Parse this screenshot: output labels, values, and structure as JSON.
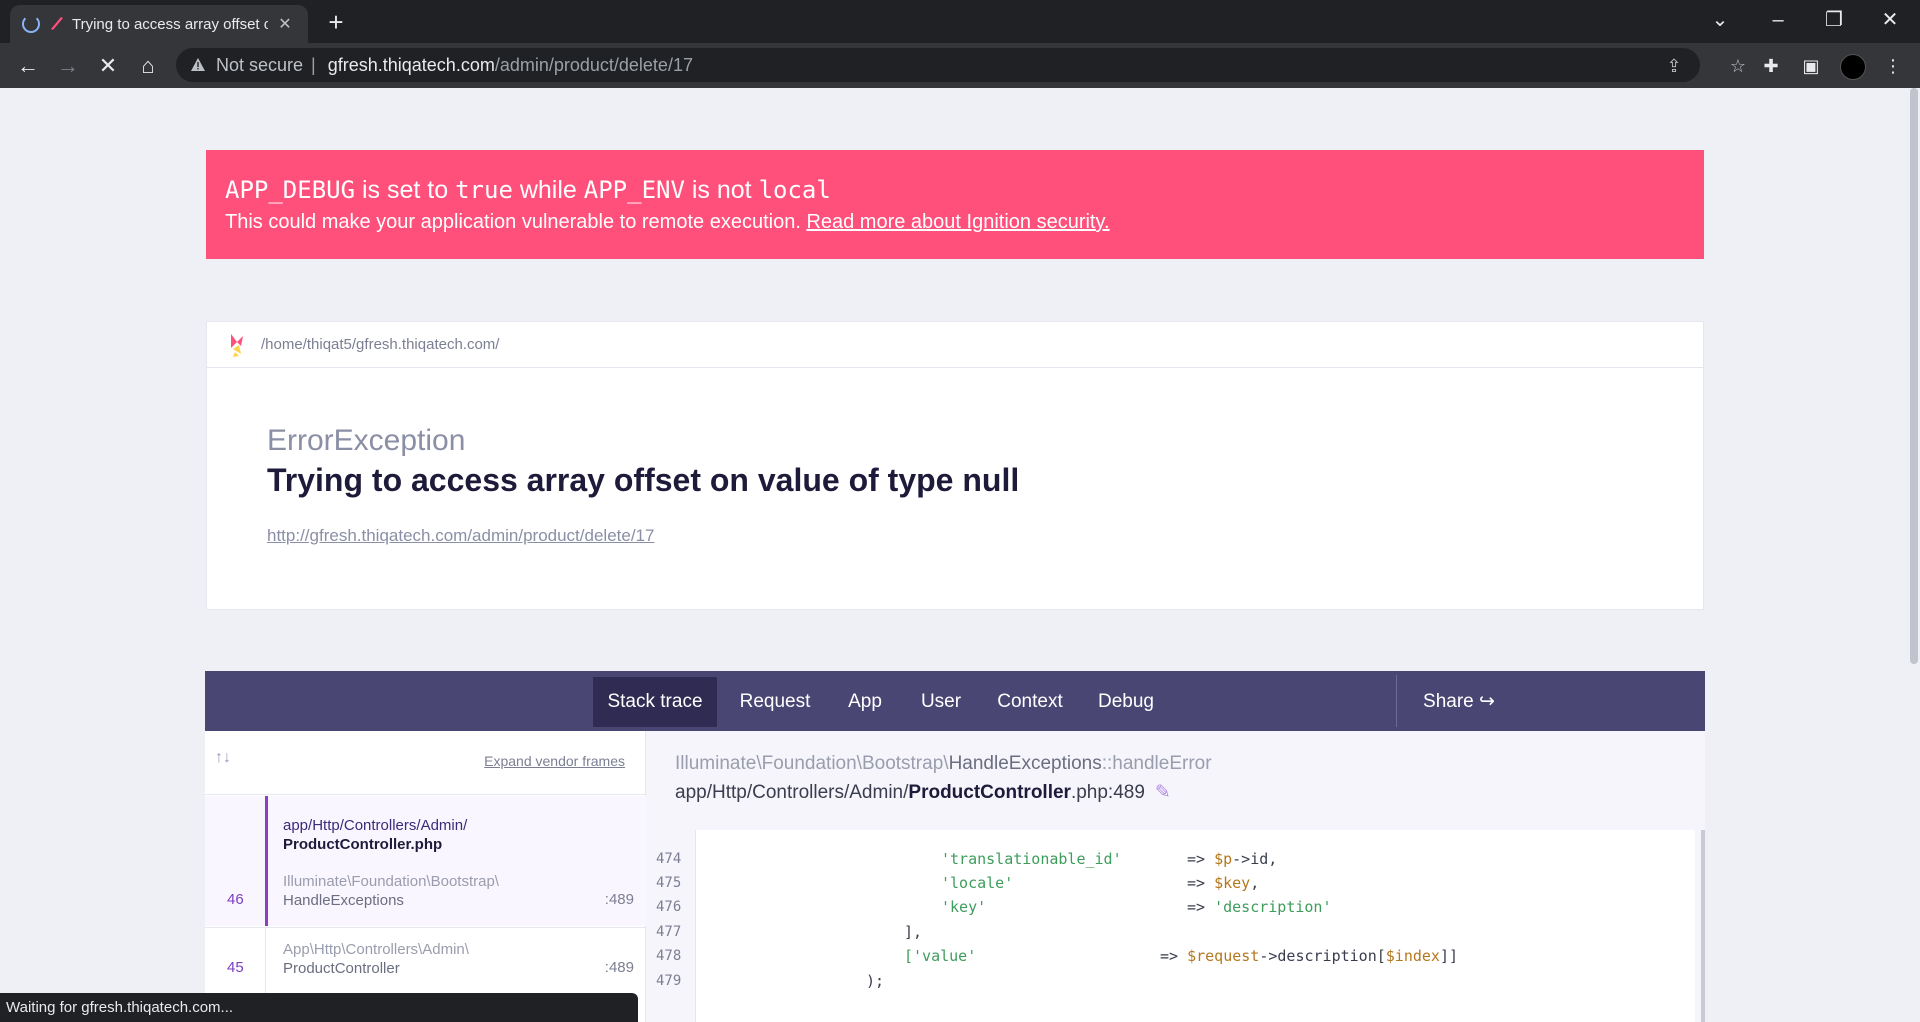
{
  "browser": {
    "tab_title": "Trying to access array offset on value of type null",
    "tab_close": "✕",
    "new_tab": "+",
    "not_secure": "Not secure",
    "url_host": "gfresh.thiqatech.com",
    "url_path": "/admin/product/delete/17",
    "status": "Waiting for gfresh.thiqatech.com..."
  },
  "banner": {
    "prefix_code": "APP_DEBUG",
    "text1": " is set to ",
    "code2": "true",
    "text2": " while ",
    "code3": "APP_ENV",
    "text3": " is not ",
    "code4": "local",
    "body": "This could make your application vulnerable to remote execution. ",
    "link": "Read more about Ignition security."
  },
  "error": {
    "path": "/home/thiqat5/gfresh.thiqatech.com/",
    "exception_class": "ErrorException",
    "message": "Trying to access array offset on value of type null",
    "url": "http://gfresh.thiqatech.com/admin/product/delete/17"
  },
  "tabs": [
    "Stack trace",
    "Request",
    "App",
    "User",
    "Context",
    "Debug"
  ],
  "share_label": "Share",
  "frames": {
    "expand_label": "Expand vendor frames",
    "items": [
      {
        "index": "46",
        "file_dir": "app/Http/Controllers/Admin/",
        "file_name": "ProductController.php",
        "cls_ns": "Illuminate\\Foundation\\Bootstrap\\",
        "cls_name": "HandleExceptions",
        "line": ":489"
      },
      {
        "index": "45",
        "cls_ns": "App\\Http\\Controllers\\Admin\\",
        "cls_name": "ProductController",
        "line": ":489"
      }
    ]
  },
  "code": {
    "ns": "Illuminate\\Foundation\\Bootstrap\\",
    "cls": "HandleExceptions",
    "method": "::handleError",
    "file_dir": "app/Http/Controllers/Admin/",
    "file_name": "ProductController",
    "file_ext": ".php:489",
    "lines": [
      {
        "no": "474",
        "key": "'translationable_id'",
        "arrow": "=> ",
        "val_var": "$p",
        "val_rest": "->id,"
      },
      {
        "no": "475",
        "key": "'locale'",
        "arrow": "=> ",
        "val_var": "$key",
        "val_rest": ","
      },
      {
        "no": "476",
        "key": "'key'",
        "arrow": "=> ",
        "val_str": "'description'"
      },
      {
        "no": "477",
        "text": "],"
      },
      {
        "no": "478",
        "key": "['value'",
        "arrow": "=> ",
        "val_var": "$request",
        "val_mid": "->description[",
        "val_var2": "$index",
        "val_rest": "]]"
      },
      {
        "no": "479",
        "text": ");"
      }
    ]
  },
  "colors": {
    "banner": "#ff4f7b",
    "tabs_bg": "#4a4674",
    "accent": "#8b3fc1"
  }
}
